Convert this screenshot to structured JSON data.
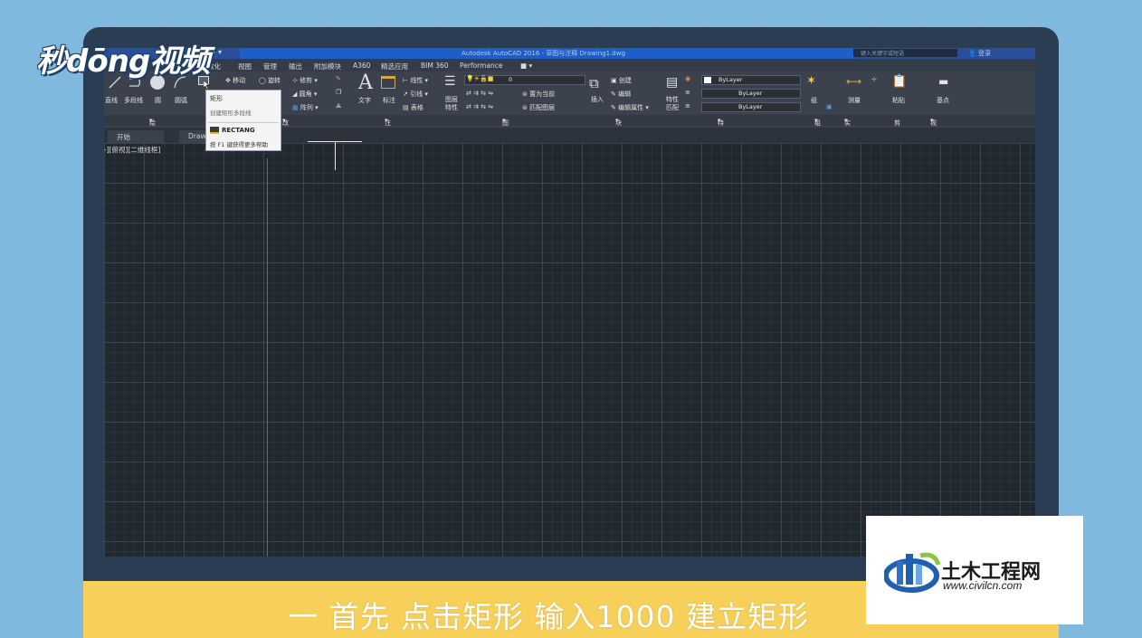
{
  "app": {
    "title": "Autodesk AutoCAD 2016  -  草图与注释    Drawing1.dwg",
    "search_placeholder": "键入关键字或短语",
    "login": "登录"
  },
  "menu": [
    "数化",
    "视图",
    "管理",
    "输出",
    "附加模块",
    "A360",
    "精选应用",
    "BIM 360",
    "Performance"
  ],
  "ribbon": {
    "draw_tools": [
      "直线",
      "多段线",
      "圆",
      "圆弧"
    ],
    "modify_tools": [
      "移动",
      "旋转",
      "修剪",
      "圆角",
      "阵列"
    ],
    "annotation": {
      "text": "文字",
      "dimension": "标注",
      "linear": "线性",
      "leader": "引线",
      "table": "表格"
    },
    "layers": {
      "props": "图层特性",
      "current_layer": "0",
      "make_current": "置为当前",
      "match_layer": "匹配图层"
    },
    "block": {
      "insert": "插入",
      "create": "创建",
      "edit": "编辑",
      "edit_attr": "编辑属性"
    },
    "properties": {
      "match": "特性匹配",
      "color": "ByLayer",
      "linetype": "ByLayer",
      "lineweight": "ByLayer"
    },
    "groups": {
      "group": "组"
    },
    "utilities": {
      "measure": "测量"
    },
    "clipboard": {
      "paste": "粘贴"
    },
    "view": {
      "base": "基点"
    },
    "panel_titles": {
      "draw": "绘图",
      "modify": "改",
      "annotation": "注释",
      "layers": "图层",
      "block": "块",
      "properties": "特性",
      "groups": "组",
      "utilities": "实用工具",
      "clipboard": "剪贴板",
      "view": "视图"
    }
  },
  "tooltip": {
    "title": "矩形",
    "desc": "创建矩形多段线",
    "command": "RECTANG",
    "help": "按 F1 键获得更多帮助"
  },
  "tabs": {
    "start": "开始",
    "drawing": "Draw"
  },
  "viewport_label": "-][俯视][二维线框]",
  "branding": {
    "left_logo": "秒dōng视频",
    "right_logo_name": "土木工程网",
    "right_logo_url": "www.civilcn.com"
  },
  "subtitle": "一 首先 点击矩形 输入1000 建立矩形"
}
